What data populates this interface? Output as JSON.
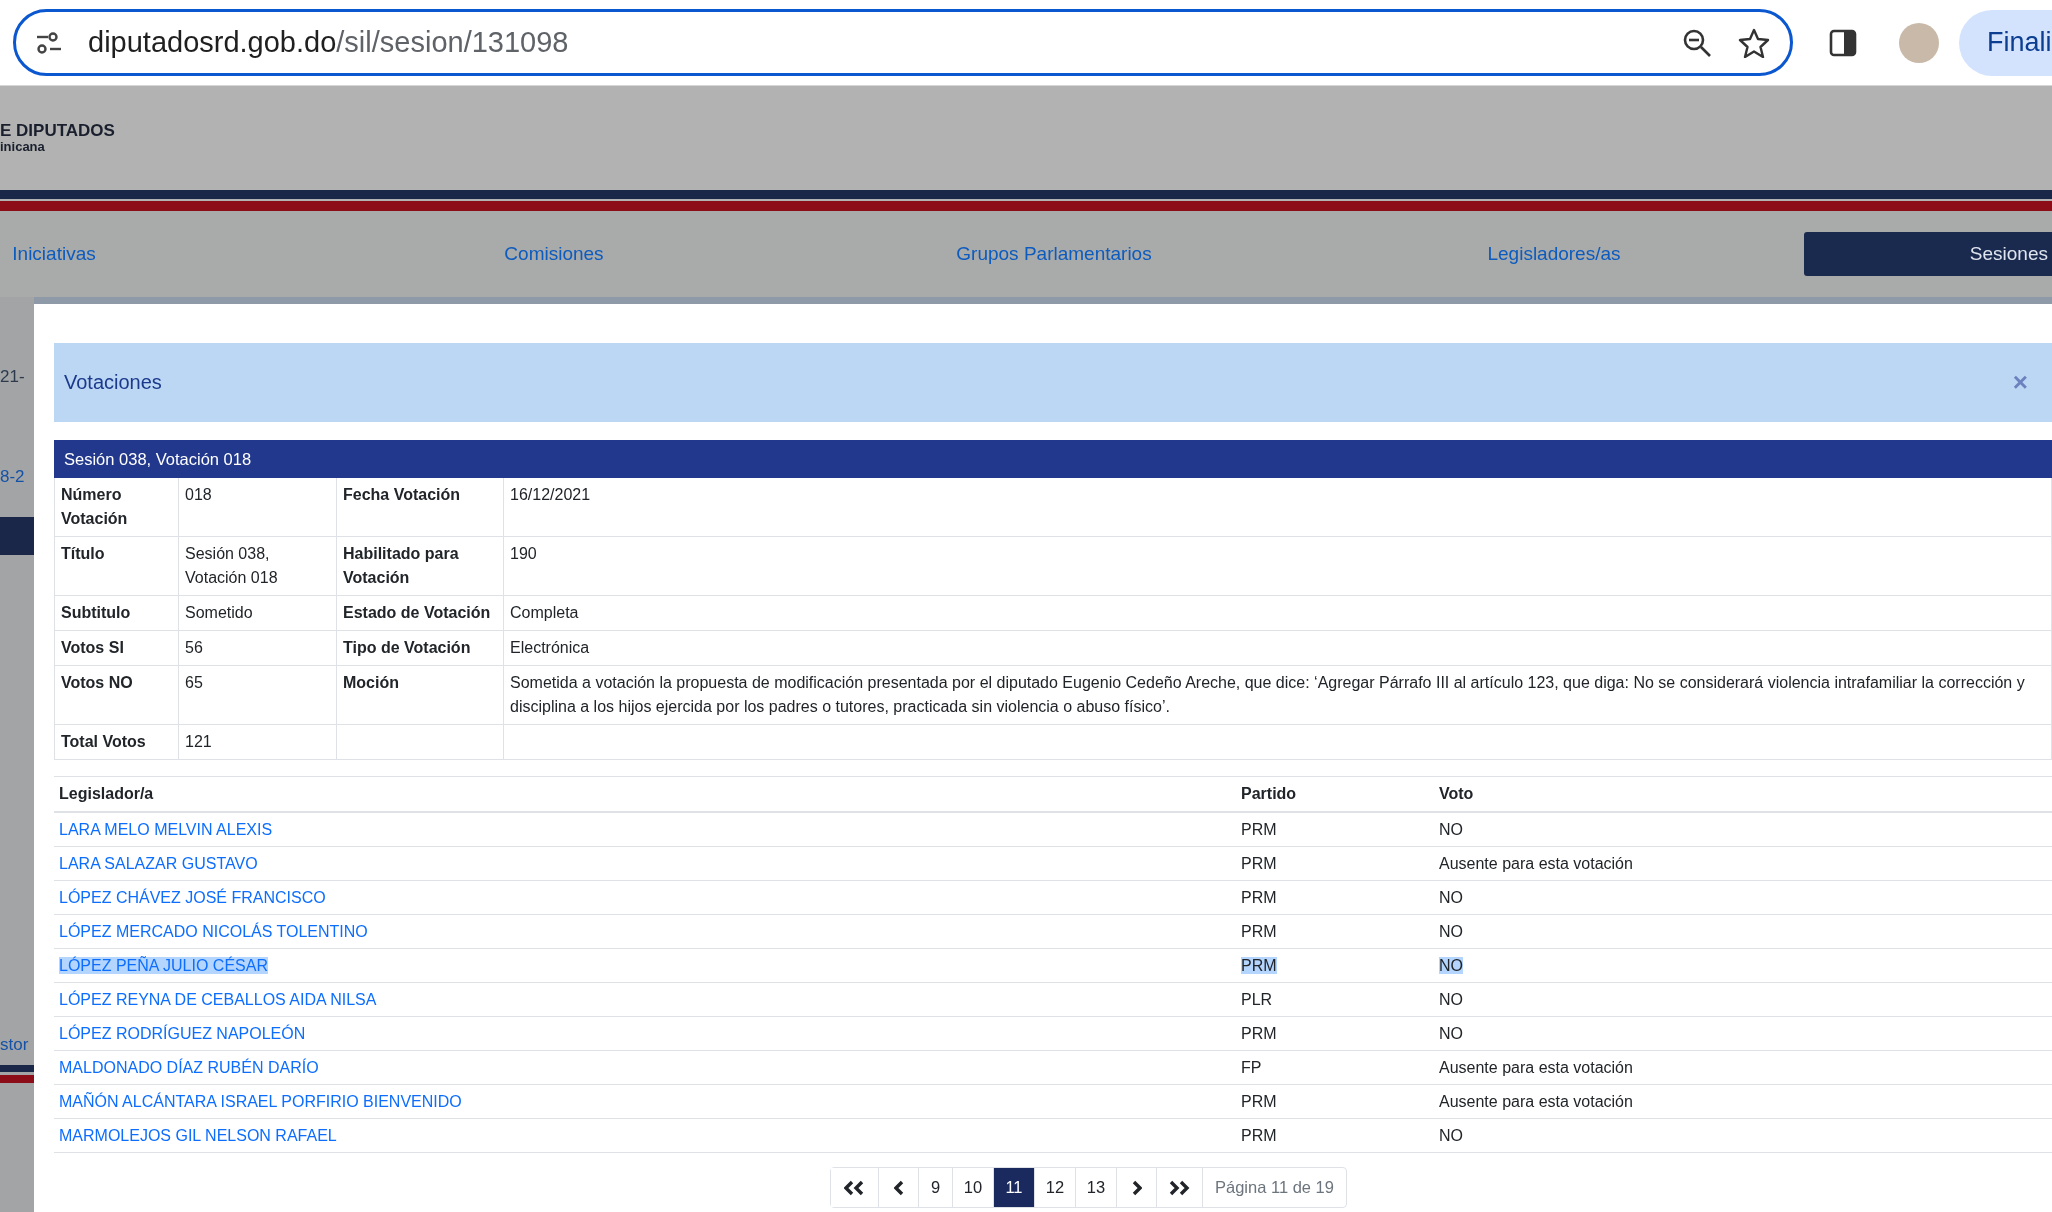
{
  "browser": {
    "url_host": "diputadosrd.gob.do",
    "url_path": "/sil/sesion/131098",
    "profile_button": "Finali"
  },
  "site_header": {
    "logo_line1": "E DIPUTADOS",
    "logo_line2": "inicana"
  },
  "nav": [
    {
      "label": "Iniciativas",
      "selected": false
    },
    {
      "label": "Comisiones",
      "selected": false
    },
    {
      "label": "Grupos Parlamentarios",
      "selected": false
    },
    {
      "label": "Legisladores/as",
      "selected": false
    },
    {
      "label": "Sesiones",
      "selected": true
    }
  ],
  "background_fragments": [
    {
      "text": "21-",
      "kind": "plain"
    },
    {
      "text": "8-2",
      "kind": "link"
    },
    {
      "text": "stor",
      "kind": "link"
    }
  ],
  "modal": {
    "title": "Votaciones",
    "close": "×",
    "panel_title": "Sesión 038, Votación 018",
    "details": [
      {
        "label": "Número Votación",
        "value": "018",
        "label2": "Fecha Votación",
        "value2": "16/12/2021"
      },
      {
        "label": "Título",
        "value": "Sesión 038, Votación 018",
        "label2": "Habilitado para Votación",
        "value2": "190"
      },
      {
        "label": "Subtitulo",
        "value": "Sometido",
        "label2": "Estado de Votación",
        "value2": "Completa"
      },
      {
        "label": "Votos SI",
        "value": "56",
        "label2": "Tipo de Votación",
        "value2": "Electrónica"
      },
      {
        "label": "Votos NO",
        "value": "65",
        "label2": "Moción",
        "value2": "Sometida a votación la propuesta de modificación presentada por el diputado Eugenio Cedeño Areche, que dice: ‘Agregar Párrafo III al artículo 123, que diga: No se considerará violencia intrafamiliar la corrección y disciplina a los hijos ejercida por los padres o tutores, practicada sin violencia o abuso físico’."
      },
      {
        "label": "Total Votos",
        "value": "121"
      }
    ],
    "votes_table": {
      "columns": [
        "Legislador/a",
        "Partido",
        "Voto"
      ],
      "rows": [
        {
          "name": "LARA MELO MELVIN ALEXIS",
          "party": "PRM",
          "vote": "NO",
          "highlighted": false
        },
        {
          "name": "LARA SALAZAR GUSTAVO",
          "party": "PRM",
          "vote": "Ausente para esta votación",
          "highlighted": false
        },
        {
          "name": "LÓPEZ CHÁVEZ JOSÉ FRANCISCO",
          "party": "PRM",
          "vote": "NO",
          "highlighted": false
        },
        {
          "name": "LÓPEZ MERCADO NICOLÁS TOLENTINO",
          "party": "PRM",
          "vote": "NO",
          "highlighted": false
        },
        {
          "name": "LÓPEZ PEÑA JULIO CÉSAR",
          "party": "PRM",
          "vote": "NO",
          "highlighted": true
        },
        {
          "name": "LÓPEZ REYNA DE CEBALLOS AIDA NILSA",
          "party": "PLR",
          "vote": "NO",
          "highlighted": false
        },
        {
          "name": "LÓPEZ RODRÍGUEZ NAPOLEÓN",
          "party": "PRM",
          "vote": "NO",
          "highlighted": false
        },
        {
          "name": "MALDONADO DÍAZ RUBÉN DARÍO",
          "party": "FP",
          "vote": "Ausente para esta votación",
          "highlighted": false
        },
        {
          "name": "MAÑÓN ALCÁNTARA ISRAEL PORFIRIO BIENVENIDO",
          "party": "PRM",
          "vote": "Ausente para esta votación",
          "highlighted": false
        },
        {
          "name": "MARMOLEJOS GIL NELSON RAFAEL",
          "party": "PRM",
          "vote": "NO",
          "highlighted": false
        }
      ]
    },
    "pagination": {
      "pages": [
        {
          "label": "9",
          "selected": false
        },
        {
          "label": "10",
          "selected": false
        },
        {
          "label": "11",
          "selected": true
        },
        {
          "label": "12",
          "selected": false
        },
        {
          "label": "13",
          "selected": false
        }
      ],
      "page_info": "Página 11 de 19"
    }
  }
}
